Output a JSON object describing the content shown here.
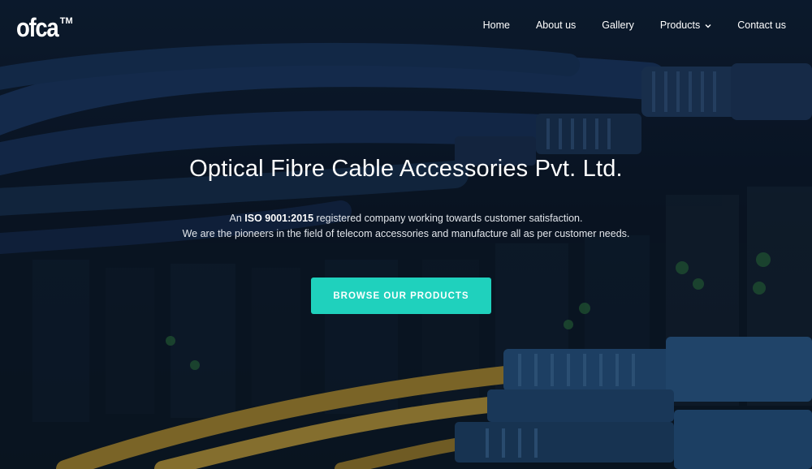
{
  "brand": {
    "name": "ofca",
    "trademark": "TM"
  },
  "nav": {
    "items": [
      {
        "label": "Home"
      },
      {
        "label": "About us"
      },
      {
        "label": "Gallery"
      },
      {
        "label": "Products",
        "has_dropdown": true
      },
      {
        "label": "Contact us"
      }
    ]
  },
  "hero": {
    "title": "Optical Fibre Cable Accessories Pvt. Ltd.",
    "subtitle_line1_prefix": "An ",
    "subtitle_line1_bold": "ISO 9001:2015",
    "subtitle_line1_suffix": " registered company working towards customer satisfaction.",
    "subtitle_line2": "We are the pioneers in the field of telecom accessories and manufacture all as per customer needs.",
    "cta_label": "BROWSE OUR PRODUCTS"
  },
  "colors": {
    "accent": "#1fd1bd",
    "background": "#0c1828",
    "blue_cable": "#1c3a66",
    "yellow_cable": "#c8a23a"
  },
  "icons": {
    "dropdown": "chevron-down-icon"
  }
}
